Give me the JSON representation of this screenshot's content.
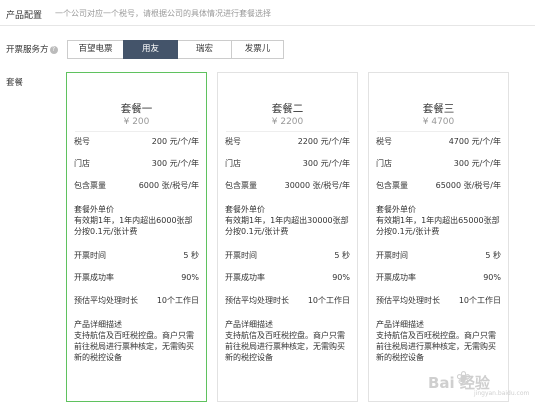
{
  "header": {
    "title": "产品配置",
    "description": "一个公司对应一个税号，请根据公司的具体情况进行套餐选择"
  },
  "labels": {
    "service_provider": "开票服务方",
    "package": "套餐"
  },
  "tabs": [
    {
      "label": "百望电票",
      "active": false
    },
    {
      "label": "用友",
      "active": true
    },
    {
      "label": "瑞宏",
      "active": false
    },
    {
      "label": "发票儿",
      "active": false
    }
  ],
  "packages": [
    {
      "name": "套餐一",
      "price": "¥ 200",
      "selected": true,
      "tax_no_label": "税号",
      "tax_no_value": "200 元/个/年",
      "store_label": "门店",
      "store_value": "300 元/个/年",
      "invoices_label": "包含票量",
      "invoices_value": "6000 张/税号/年",
      "extra_title": "套餐外单价",
      "extra_desc": "有效期1年，1年内超出6000张部分按0.1元/张计费",
      "issue_time_label": "开票时间",
      "issue_time_value": "5 秒",
      "success_label": "开票成功率",
      "success_value": "90%",
      "process_label": "预估平均处理时长",
      "process_value": "10个工作日",
      "detail_title": "产品详细描述",
      "detail_desc": "支持航信及百旺税控盘。商户只需前往税局进行票种核定，无需购买新的税控设备"
    },
    {
      "name": "套餐二",
      "price": "¥ 2200",
      "selected": false,
      "tax_no_label": "税号",
      "tax_no_value": "2200 元/个/年",
      "store_label": "门店",
      "store_value": "300 元/个/年",
      "invoices_label": "包含票量",
      "invoices_value": "30000 张/税号/年",
      "extra_title": "套餐外单价",
      "extra_desc": "有效期1年，1年内超出30000张部分按0.1元/张计费",
      "issue_time_label": "开票时间",
      "issue_time_value": "5 秒",
      "success_label": "开票成功率",
      "success_value": "90%",
      "process_label": "预估平均处理时长",
      "process_value": "10个工作日",
      "detail_title": "产品详细描述",
      "detail_desc": "支持航信及百旺税控盘。商户只需前往税局进行票种核定，无需购买新的税控设备"
    },
    {
      "name": "套餐三",
      "price": "¥ 4700",
      "selected": false,
      "tax_no_label": "税号",
      "tax_no_value": "4700 元/个/年",
      "store_label": "门店",
      "store_value": "300 元/个/年",
      "invoices_label": "包含票量",
      "invoices_value": "65000 张/税号/年",
      "extra_title": "套餐外单价",
      "extra_desc": "有效期1年，1年内超出65000张部分按0.1元/张计费",
      "issue_time_label": "开票时间",
      "issue_time_value": "5 秒",
      "success_label": "开票成功率",
      "success_value": "90%",
      "process_label": "预估平均处理时长",
      "process_value": "10个工作日",
      "detail_title": "产品详细描述",
      "detail_desc": "支持航信及百旺税控盘。商户只需前往税局进行票种核定，无需购买新的税控设备"
    }
  ],
  "watermark": {
    "text": "Bai 经验",
    "sub": "jingyan.baidu.com"
  }
}
